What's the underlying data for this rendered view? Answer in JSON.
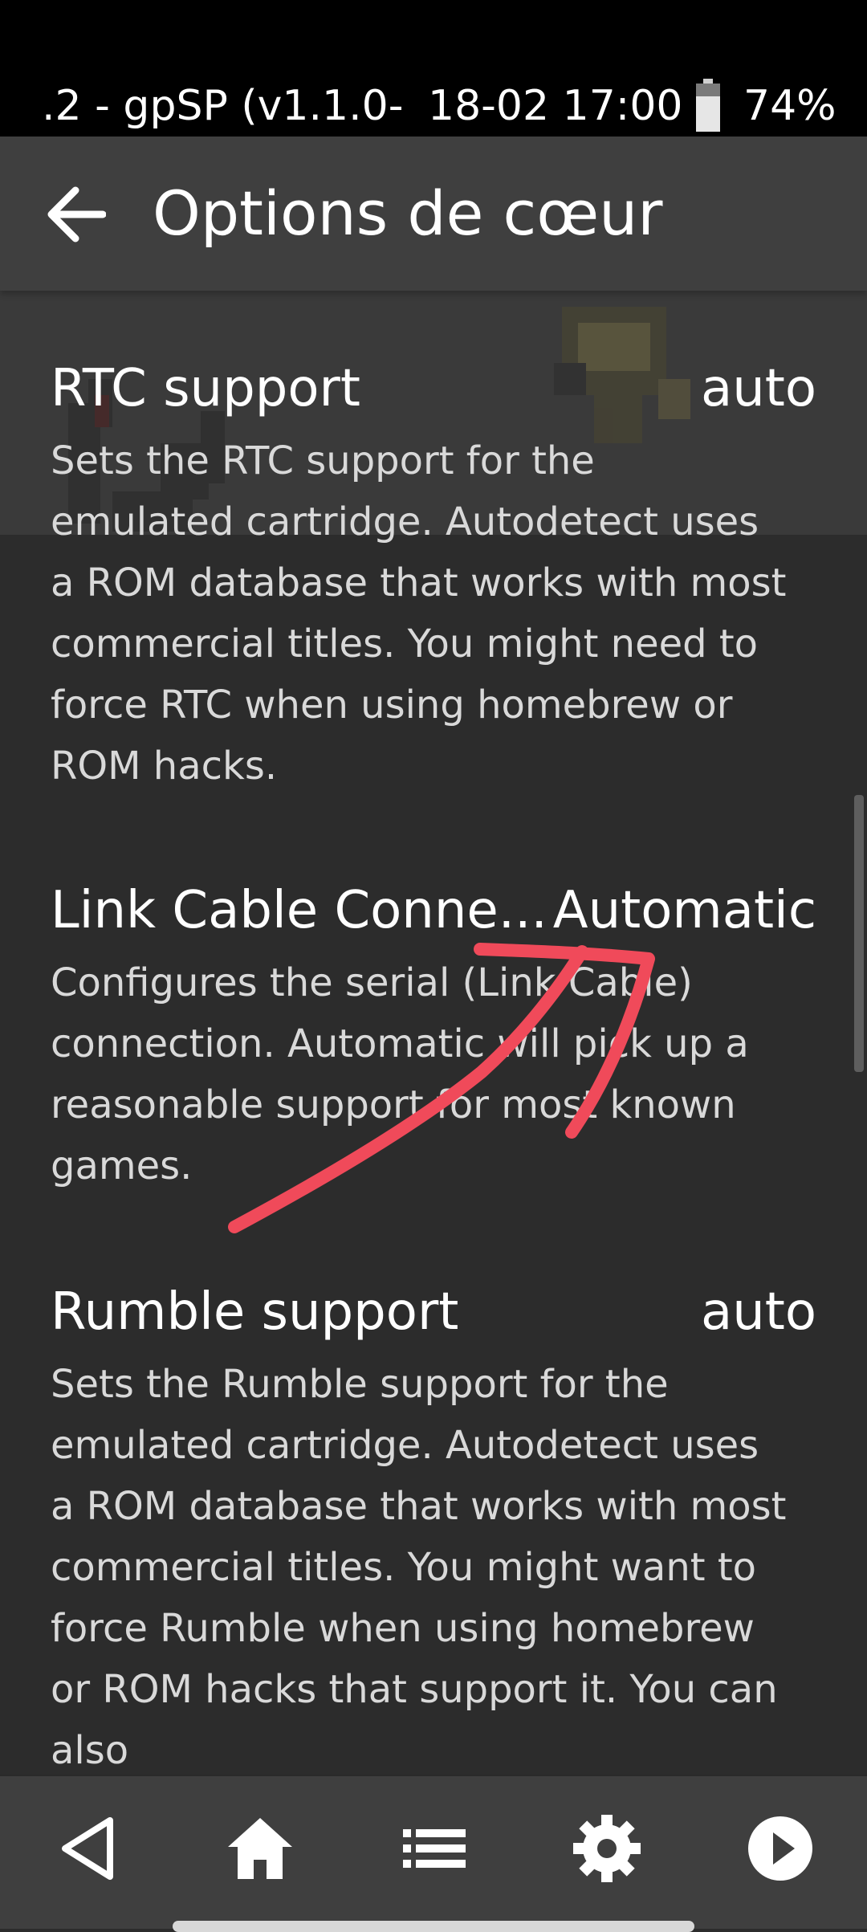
{
  "status_bar": {
    "notification": ".2 - gpSP (v1.1.0-",
    "datetime": "18-02 17:00",
    "battery": "74%"
  },
  "app_bar": {
    "title": "Options de cœur"
  },
  "options": [
    {
      "title": "RTC support",
      "value": "auto",
      "description": "Sets the RTC support for the emulated cartridge. Autodetect uses a ROM database that works with most commercial titles. You might need to force RTC when using homebrew or ROM hacks."
    },
    {
      "title": "Link Cable Conne...",
      "value": "Automatic",
      "description": "Configures the serial (Link Cable) connection. Automatic will pick up a reasonable support for most known games."
    },
    {
      "title": "Rumble support",
      "value": "auto",
      "description": "Sets the Rumble support for the emulated cartridge. Autodetect uses a ROM database that works with most commercial titles. You might want to force Rumble when using homebrew or ROM hacks that support it. You can also"
    }
  ],
  "nav_bar": {
    "icons": [
      "back-triangle-icon",
      "home-icon",
      "list-icon",
      "gear-icon",
      "play-icon"
    ]
  },
  "colors": {
    "background": "#2c2c2c",
    "app_bar": "#3f3f3f",
    "annotation": "#f04a5a"
  }
}
